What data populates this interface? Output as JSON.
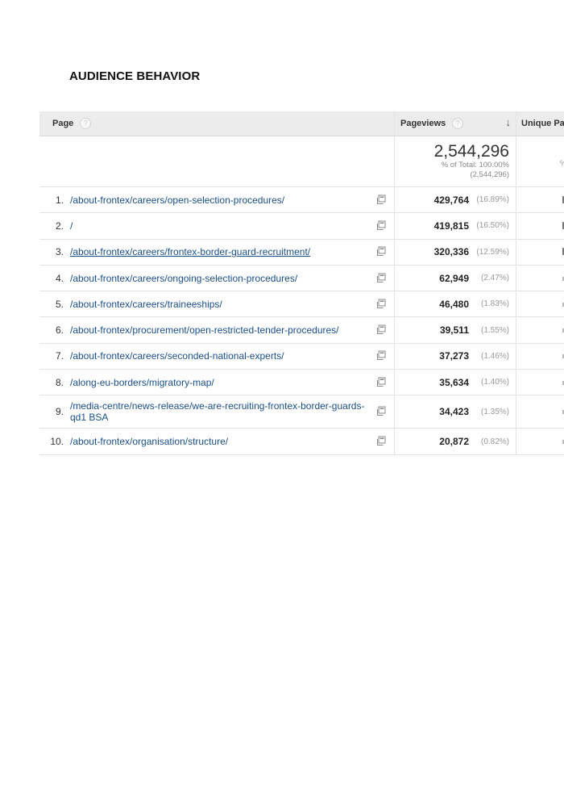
{
  "heading": "AUDIENCE BEHAVIOR",
  "table": {
    "col_page": "Page",
    "col_pageviews": "Pageviews",
    "col_unique": "Unique Pag",
    "help_glyph": "?",
    "sort_glyph": "↓",
    "totals": {
      "pageviews": "2,544,296",
      "pct_label": "% of Total: 100.00%",
      "pct_value": "(2,544,296)",
      "unique_clip": "%"
    },
    "rows": [
      {
        "index": "1.",
        "page": "/about-frontex/careers/open-selection-procedures/",
        "pageviews": "429,764",
        "pct": "(16.89%)"
      },
      {
        "index": "2.",
        "page": "/",
        "pageviews": "419,815",
        "pct": "(16.50%)"
      },
      {
        "index": "3.",
        "page": "/about-frontex/careers/frontex-border-guard-recruitment/",
        "pageviews": "320,336",
        "pct": "(12.59%)"
      },
      {
        "index": "4.",
        "page": "/about-frontex/careers/ongoing-selection-procedures/",
        "pageviews": "62,949",
        "pct": "(2.47%)"
      },
      {
        "index": "5.",
        "page": "/about-frontex/careers/traineeships/",
        "pageviews": "46,480",
        "pct": "(1.83%)"
      },
      {
        "index": "6.",
        "page": "/about-frontex/procurement/open-restricted-tender-procedures/",
        "pageviews": "39,511",
        "pct": "(1.55%)"
      },
      {
        "index": "7.",
        "page": "/about-frontex/careers/seconded-national-experts/",
        "pageviews": "37,273",
        "pct": "(1.46%)"
      },
      {
        "index": "8.",
        "page": "/along-eu-borders/migratory-map/",
        "pageviews": "35,634",
        "pct": "(1.40%)"
      },
      {
        "index": "9.",
        "page": "/media-centre/news-release/we-are-recruiting-frontex-border-guards-qd1 BSA",
        "pageviews": "34,423",
        "pct": "(1.35%)"
      },
      {
        "index": "10.",
        "page": "/about-frontex/organisation/structure/",
        "pageviews": "20,872",
        "pct": "(0.82%)"
      }
    ]
  },
  "icons": {
    "copy": "open-in-new-window-icon",
    "help": "help-icon",
    "sort": "sort-descending-icon"
  }
}
